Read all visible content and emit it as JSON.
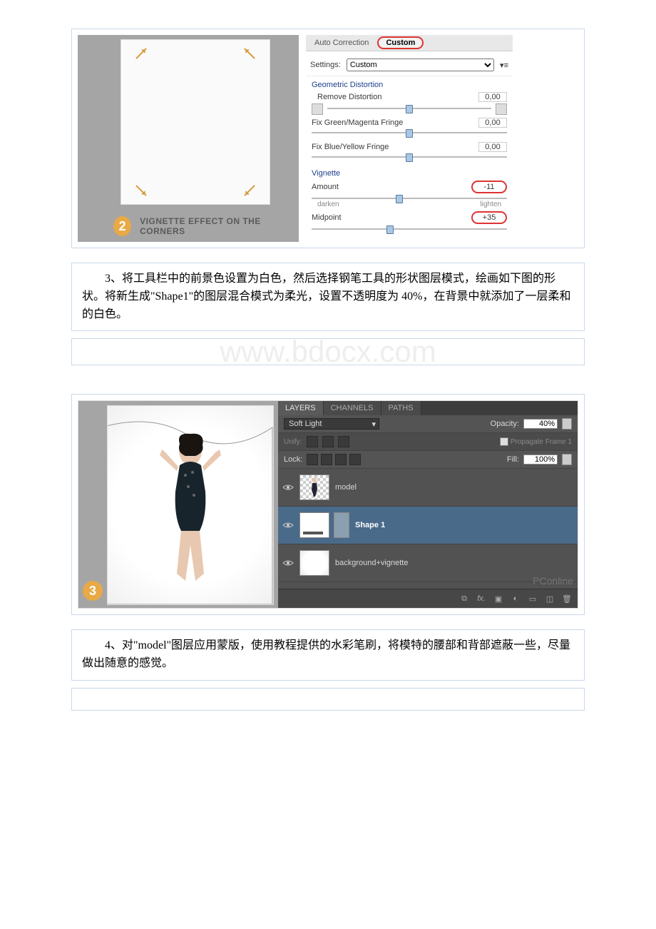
{
  "fig1": {
    "step_number": "2",
    "step_label": "VIGNETTE EFFECT ON THE CORNERS",
    "tabs": [
      "Auto Correction",
      "Custom"
    ],
    "settings_label": "Settings:",
    "settings_value": "Custom",
    "section_geom": "Geometric Distortion",
    "remove_distortion_label": "Remove Distortion",
    "remove_distortion_value": "0,00",
    "fix_gm_label": "Fix Green/Magenta Fringe",
    "fix_gm_value": "0,00",
    "fix_by_label": "Fix Blue/Yellow Fringe",
    "fix_by_value": "0,00",
    "vignette_title": "Vignette",
    "amount_label": "Amount",
    "amount_value": "-11",
    "darken": "darken",
    "lighten": "lighten",
    "midpoint_label": "Midpoint",
    "midpoint_value": "+35"
  },
  "text1": "3、将工具栏中的前景色设置为白色，然后选择钢笔工具的形状图层模式，绘画如下图的形状。将新生成\"Shape1\"的图层混合模式为柔光，设置不透明度为 40%，在背景中就添加了一层柔和的白色。",
  "watermark": "www.bdocx.com",
  "fig2": {
    "step_number": "3",
    "tabs": [
      "LAYERS",
      "CHANNELS",
      "PATHS"
    ],
    "blend_mode": "Soft Light",
    "opacity_label": "Opacity:",
    "opacity_value": "40%",
    "unify_label": "Unify:",
    "propagate_label": "Propagate Frame 1",
    "lock_label": "Lock:",
    "fill_label": "Fill:",
    "fill_value": "100%",
    "layers": [
      {
        "name": "model"
      },
      {
        "name": "Shape 1"
      },
      {
        "name": "background+vignette"
      }
    ],
    "footer_icons": [
      "link",
      "fx",
      "mask",
      "adjust",
      "group",
      "new",
      "trash"
    ]
  },
  "text2": "4、对\"model\"图层应用蒙版，使用教程提供的水彩笔刷，将模特的腰部和背部遮蔽一些，尽量做出随意的感觉。"
}
